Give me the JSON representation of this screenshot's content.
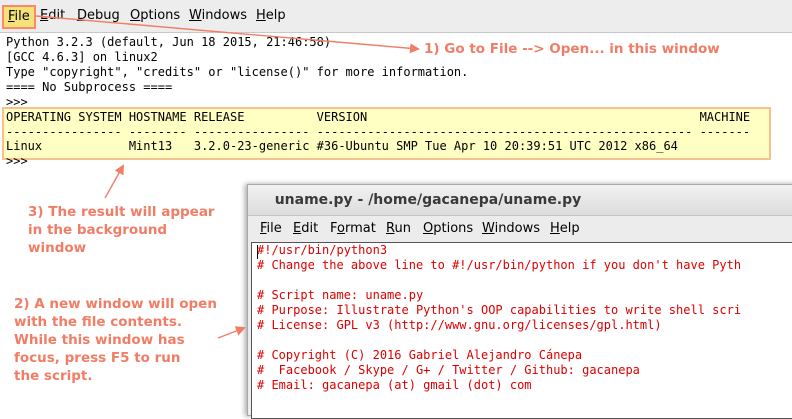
{
  "main_menu": [
    {
      "label": "File",
      "ul": "F",
      "rest": "ile"
    },
    {
      "label": "Edit",
      "ul": "E",
      "rest": "dit"
    },
    {
      "label": "Debug",
      "ul": "D",
      "rest": "ebug"
    },
    {
      "label": "Options",
      "ul": "O",
      "rest": "ptions"
    },
    {
      "label": "Windows",
      "ul": "W",
      "rest": "indows"
    },
    {
      "label": "Help",
      "ul": "H",
      "rest": "elp"
    }
  ],
  "shell": {
    "lines": [
      "Python 3.2.3 (default, Jun 18 2015, 21:46:58)",
      "[GCC 4.6.3] on linux2",
      "Type \"copyright\", \"credits\" or \"license()\" for more information.",
      "==== No Subprocess ====",
      ">>>"
    ],
    "table_header": "OPERATING SYSTEM HOSTNAME RELEASE          VERSION                                              MACHINE",
    "table_sep": "---------------- -------- ---------------- ---------------------------------------------------- -------",
    "table_row": "Linux            Mint13   3.2.0-23-generic #36-Ubuntu SMP Tue Apr 10 20:39:51 UTC 2012 x86_64",
    "prompt_after": ">>>"
  },
  "annotations": {
    "a1": "1) Go to File --> Open... in this window",
    "a3": [
      "3) The result will appear",
      "in the background",
      "window"
    ],
    "a2": [
      "2) A new window will open",
      "with the file contents.",
      "While this window has",
      "focus, press F5 to run",
      "the script."
    ]
  },
  "editor": {
    "title": "uname.py - /home/gacanepa/uname.py",
    "menu": [
      {
        "label": "File",
        "ul": "F",
        "rest": "ile"
      },
      {
        "label": "Edit",
        "ul": "E",
        "rest": "dit"
      },
      {
        "label": "Format",
        "pre": "F",
        "ul": "o",
        "rest": "rmat"
      },
      {
        "label": "Run",
        "ul": "R",
        "rest": "un"
      },
      {
        "label": "Options",
        "ul": "O",
        "rest": "ptions"
      },
      {
        "label": "Windows",
        "ul": "W",
        "rest": "indows"
      },
      {
        "label": "Help",
        "ul": "H",
        "rest": "elp"
      }
    ],
    "lines": [
      "#!/usr/bin/python3",
      "# Change the above line to #!/usr/bin/python if you don't have Pyth",
      "",
      "# Script name: uname.py",
      "# Purpose: Illustrate Python's OOP capabilities to write shell scri",
      "# License: GPL v3 (http://www.gnu.org/licenses/gpl.html)",
      "",
      "# Copyright (C) 2016 Gabriel Alejandro Cánepa",
      "#  Facebook / Skype / G+ / Twitter / Github: gacanepa",
      "# Email: gacanepa (at) gmail (dot) com"
    ]
  },
  "colors": {
    "annotation": "#f07d66",
    "highlight": "#ffffc4",
    "comment": "#dd0000"
  }
}
